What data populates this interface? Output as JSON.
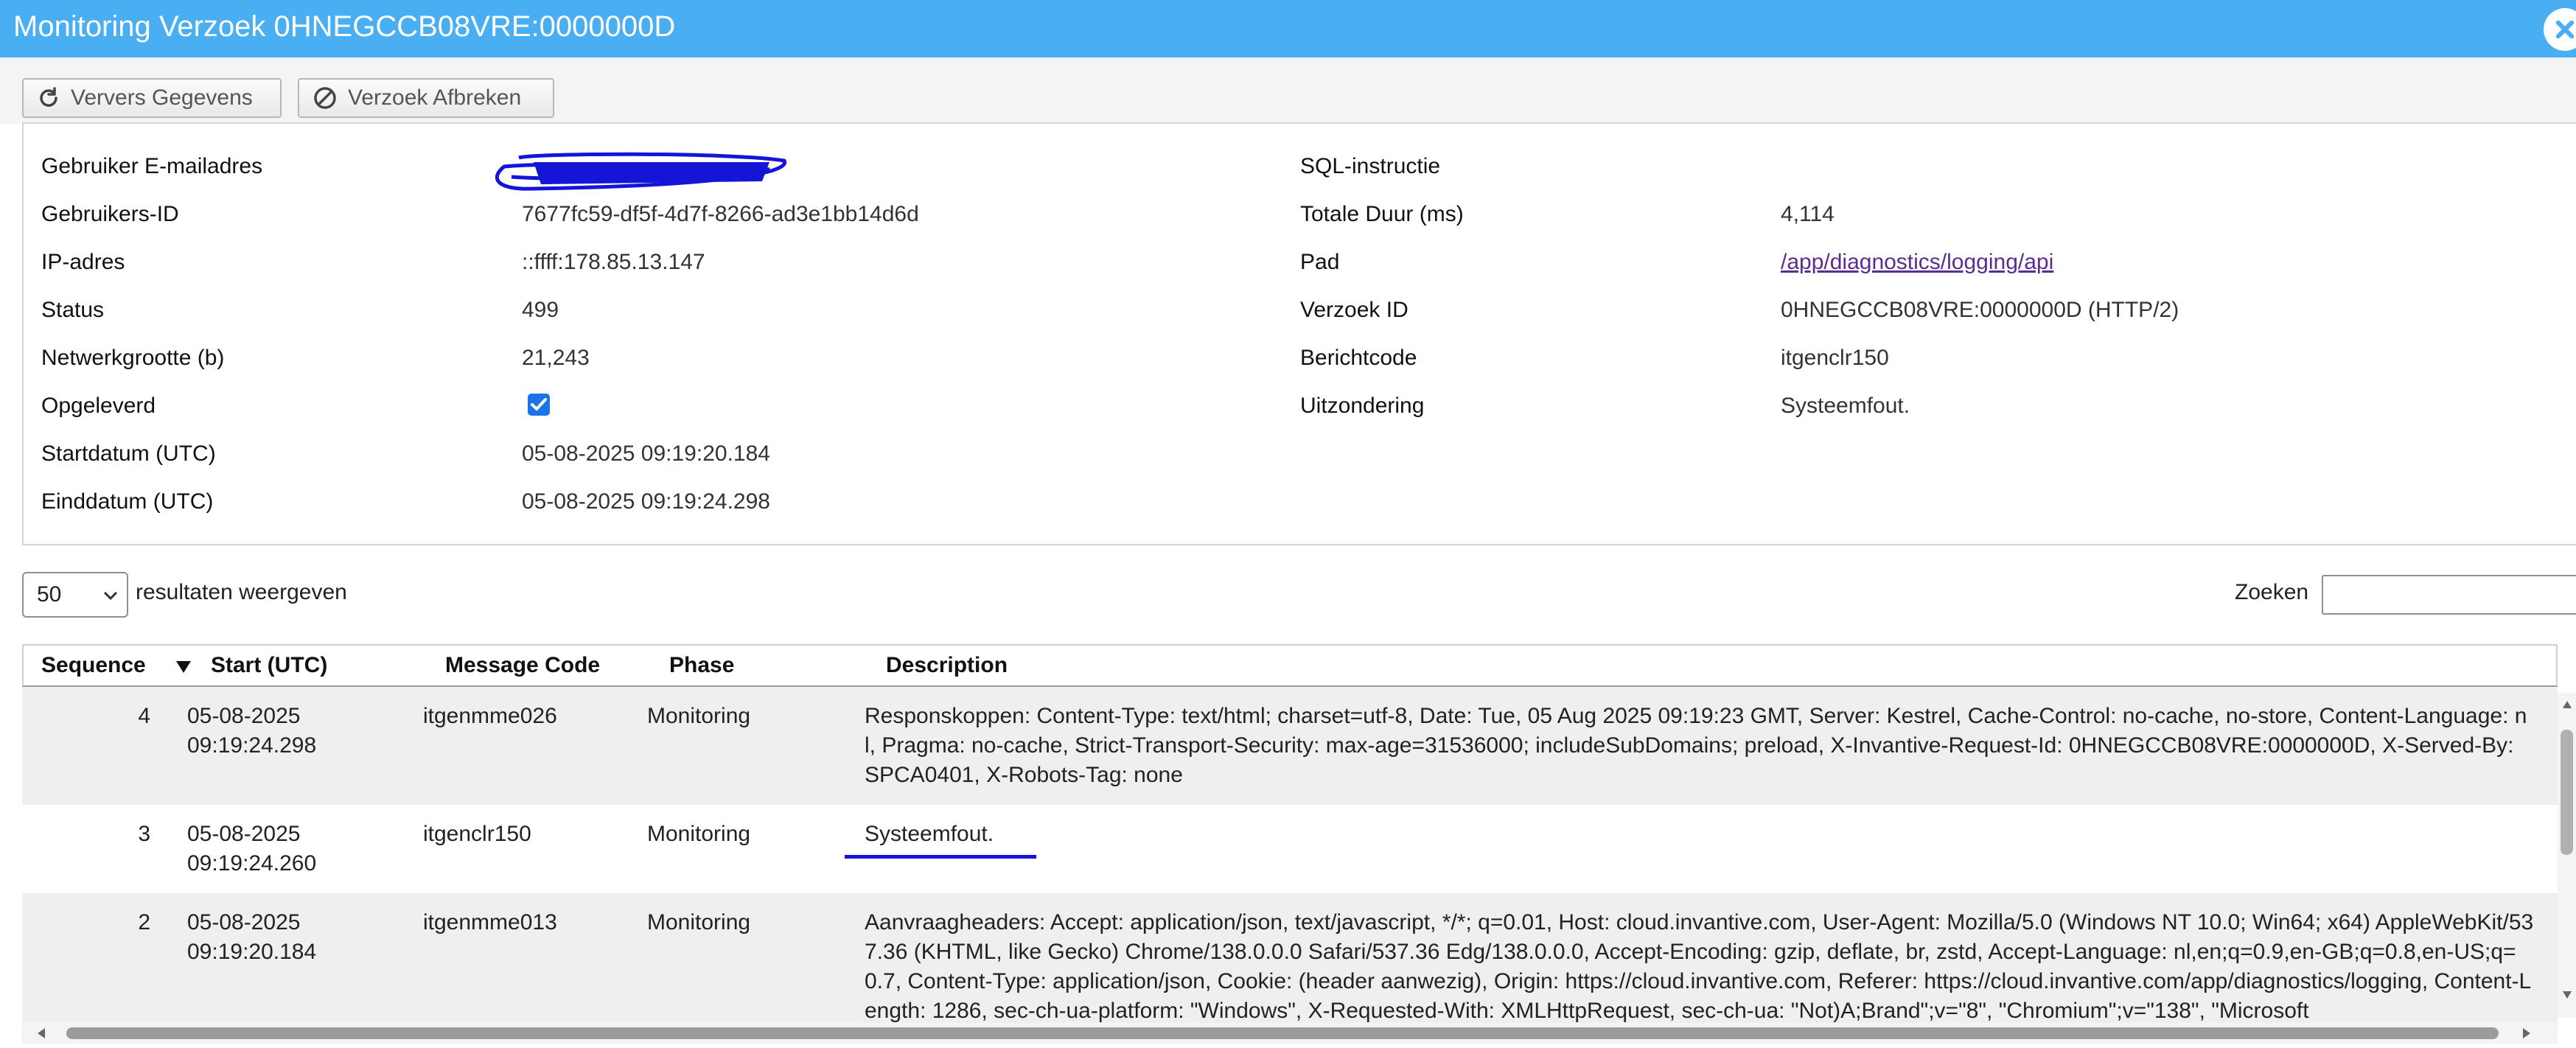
{
  "window": {
    "title": "Monitoring Verzoek 0HNEGCCB08VRE:0000000D"
  },
  "toolbar": {
    "refresh_label": "Ververs Gegevens",
    "abort_label": "Verzoek Afbreken"
  },
  "details": {
    "left": [
      {
        "label": "Gebruiker E-mailadres",
        "value": ""
      },
      {
        "label": "Gebruikers-ID",
        "value": "7677fc59-df5f-4d7f-8266-ad3e1bb14d6d"
      },
      {
        "label": "IP-adres",
        "value": "::ffff:178.85.13.147"
      },
      {
        "label": "Status",
        "value": "499"
      },
      {
        "label": "Netwerkgrootte (b)",
        "value": "21,243"
      },
      {
        "label": "Opgeleverd",
        "value": ""
      },
      {
        "label": "Startdatum (UTC)",
        "value": "05-08-2025 09:19:20.184"
      },
      {
        "label": "Einddatum (UTC)",
        "value": "05-08-2025 09:19:24.298"
      }
    ],
    "right": [
      {
        "label": "SQL-instructie",
        "value": ""
      },
      {
        "label": "Totale Duur (ms)",
        "value": "4,114"
      },
      {
        "label": "Pad",
        "value": "/app/diagnostics/logging/api"
      },
      {
        "label": "Verzoek ID",
        "value": "0HNEGCCB08VRE:0000000D (HTTP/2)"
      },
      {
        "label": "Berichtcode",
        "value": "itgenclr150"
      },
      {
        "label": "Uitzondering",
        "value": "Systeemfout."
      }
    ],
    "delivered_checked": true
  },
  "list_controls": {
    "page_length": "50",
    "length_label": "resultaten weergeven",
    "search_label": "Zoeken",
    "search_value": ""
  },
  "table": {
    "columns": [
      "Sequence",
      "Start (UTC)",
      "Message Code",
      "Phase",
      "Description"
    ],
    "sort_column": "Sequence",
    "sort_direction": "descending",
    "rows": [
      {
        "sequence": "4",
        "start": "05-08-2025 09:19:24.298",
        "code": "itgenmme026",
        "phase": "Monitoring",
        "description": "Responskoppen: Content-Type: text/html; charset=utf-8, Date: Tue, 05 Aug 2025 09:19:23 GMT, Server: Kestrel, Cache-Control: no-cache, no-store, Content-Language: nl, Pragma: no-cache, Strict-Transport-Security: max-age=31536000; includeSubDomains; preload, X-Invantive-Request-Id: 0HNEGCCB08VRE:0000000D, X-Served-By: SPCA0401, X-Robots-Tag: none"
      },
      {
        "sequence": "3",
        "start": "05-08-2025 09:19:24.260",
        "code": "itgenclr150",
        "phase": "Monitoring",
        "description": "Systeemfout."
      },
      {
        "sequence": "2",
        "start": "05-08-2025 09:19:20.184",
        "code": "itgenmme013",
        "phase": "Monitoring",
        "description": "Aanvraagheaders: Accept: application/json, text/javascript, */*; q=0.01, Host: cloud.invantive.com, User-Agent: Mozilla/5.0 (Windows NT 10.0; Win64; x64) AppleWebKit/537.36 (KHTML, like Gecko) Chrome/138.0.0.0 Safari/537.36 Edg/138.0.0.0, Accept-Encoding: gzip, deflate, br, zstd, Accept-Language: nl,en;q=0.9,en-GB;q=0.8,en-US;q=0.7, Content-Type: application/json, Cookie: (header aanwezig), Origin: https://cloud.invantive.com, Referer: https://cloud.invantive.com/app/diagnostics/logging, Content-Length: 1286, sec-ch-ua-platform: \"Windows\", X-Requested-With: XMLHttpRequest, sec-ch-ua: \"Not)A;Brand\";v=\"8\", \"Chromium\";v=\"138\", \"Microsoft"
      }
    ]
  },
  "colors": {
    "titlebar": "#4aaef2",
    "checkbox": "#1a73e8",
    "link": "#5b2d8e",
    "annotation": "#1515d8"
  }
}
